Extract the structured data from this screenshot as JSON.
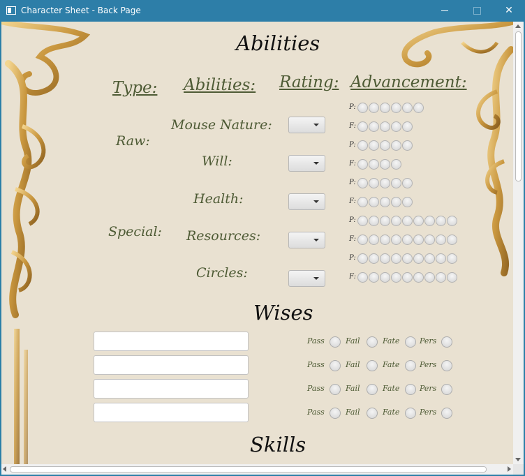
{
  "window": {
    "title": "Character Sheet - Back Page"
  },
  "abilities": {
    "heading": "Abilities",
    "col_type": "Type:",
    "col_abilities": "Abilities:",
    "col_rating": "Rating:",
    "col_advancement": "Advancement:",
    "type_raw": "Raw:",
    "type_special": "Special:",
    "rows": [
      {
        "name": "Mouse Nature:",
        "pass_count": 6,
        "fail_count": 5
      },
      {
        "name": "Will:",
        "pass_count": 5,
        "fail_count": 4
      },
      {
        "name": "Health:",
        "pass_count": 5,
        "fail_count": 5
      },
      {
        "name": "Resources:",
        "pass_count": 9,
        "fail_count": 9
      },
      {
        "name": "Circles:",
        "pass_count": 9,
        "fail_count": 9
      }
    ],
    "pass_prefix": "P:",
    "fail_prefix": "F:"
  },
  "wises": {
    "heading": "Wises",
    "labels": {
      "pass": "Pass",
      "fail": "Fail",
      "fate": "Fate",
      "pers": "Pers"
    },
    "count": 4
  },
  "skills": {
    "heading": "Skills"
  },
  "colors": {
    "background": "#e9e1d1",
    "text_olive": "#4e5b35",
    "titlebar": "#2d7ea8"
  }
}
